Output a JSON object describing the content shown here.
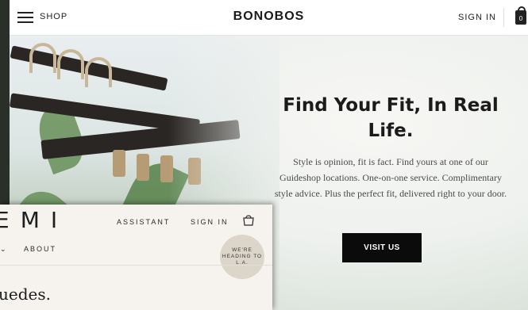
{
  "main_window": {
    "header": {
      "menu_label": "SHOP",
      "brand": "BONOBOS",
      "sign_in": "SIGN IN",
      "bag_count": "0"
    },
    "hero": {
      "title": "Find Your Fit, In Real Life.",
      "body": "Style is opinion, fit is fact. Find yours at one of our Guideshop locations. One-on-one service. Complimentary style advice. Plus the perfect fit, delivered right to your door.",
      "cta": "VISIT US"
    }
  },
  "front_window": {
    "logo": "EMI",
    "nav_assistant": "ASSISTANT",
    "nav_sign_in": "SIGN IN",
    "nav_chevron": "⌄",
    "nav_about": "ABOUT",
    "badge": "WE'RE HEADING TO L.A.",
    "heading": "uedes."
  },
  "colors": {
    "cta_background": "#0b0b0b",
    "header_background": "#ffffff",
    "front_background": "#f6f3ee"
  },
  "icons": [
    "menu-icon",
    "bag-icon",
    "shopping-bag-icon"
  ]
}
